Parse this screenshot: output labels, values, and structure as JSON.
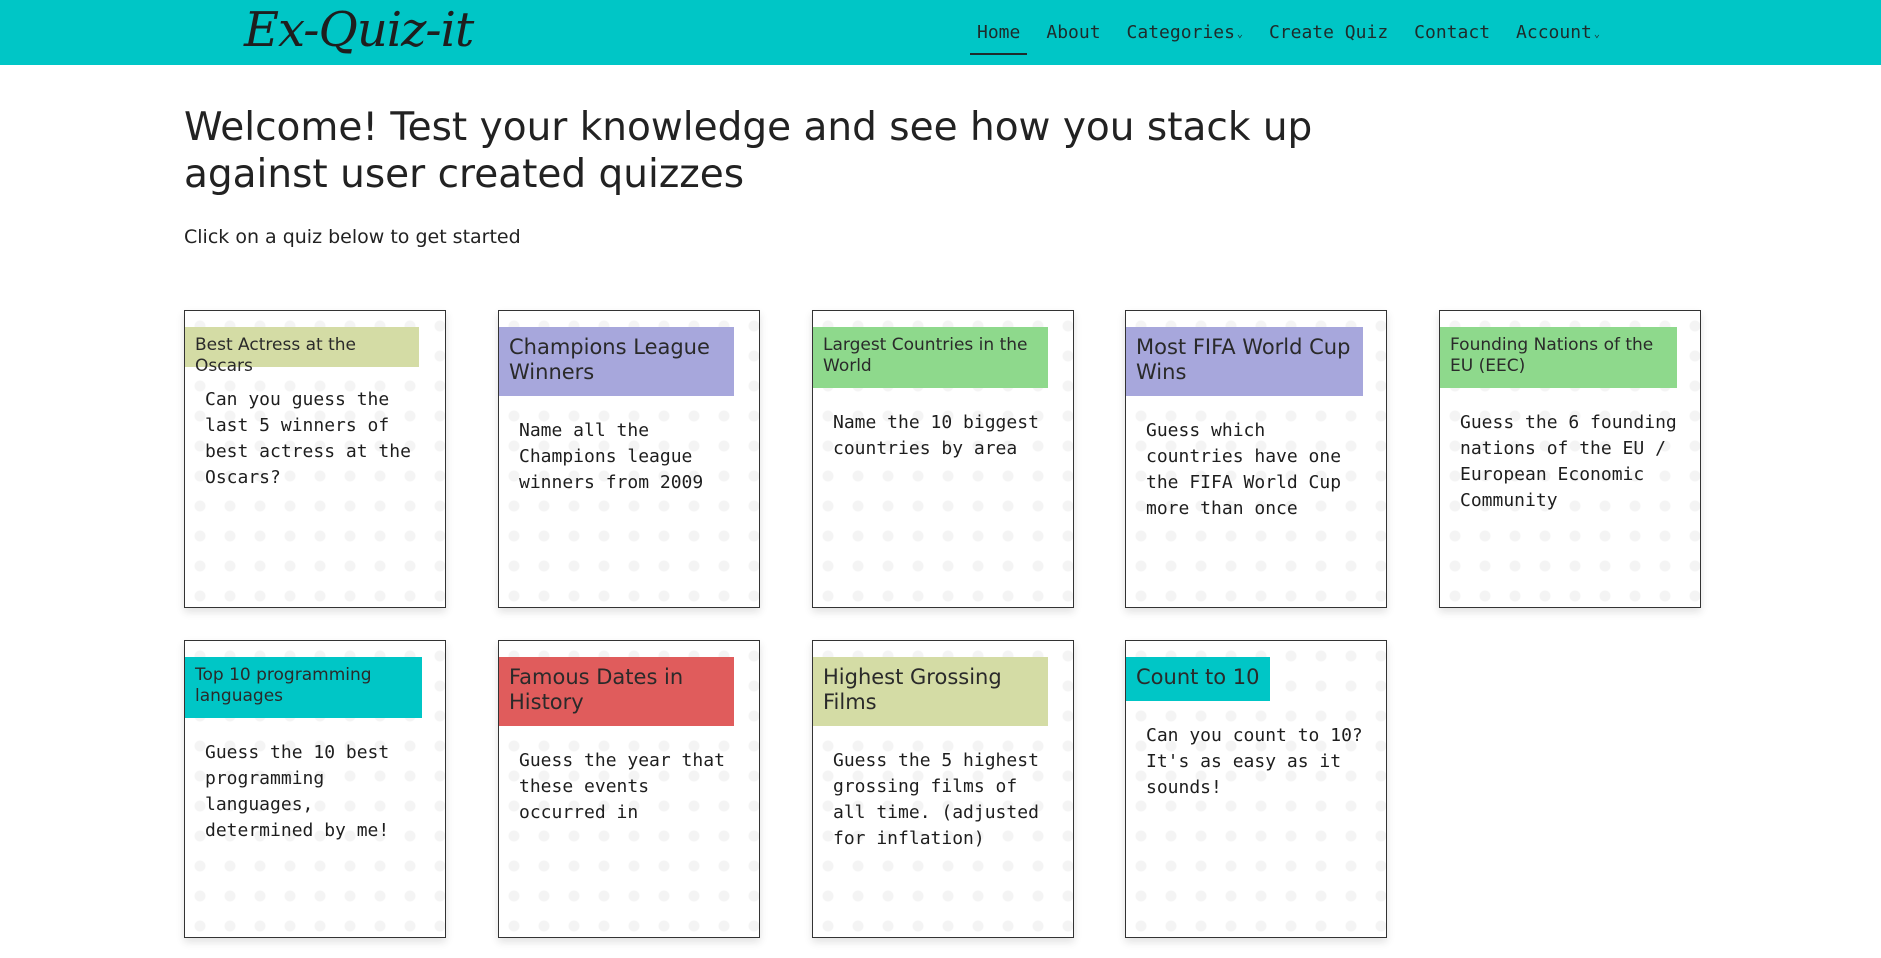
{
  "brand": "Ex-Quiz-it",
  "nav": {
    "home": "Home",
    "about": "About",
    "categories": "Categories",
    "create_quiz": "Create Quiz",
    "contact": "Contact",
    "account": "Account",
    "caret": "⌄"
  },
  "hero": {
    "title": "Welcome! Test your knowledge and see how you stack up against user created quizzes",
    "subtitle": "Click on a quiz below to get started"
  },
  "quizzes": [
    {
      "title": "Best Actress at the Oscars",
      "description": "Can you guess the last 5 winners of best actress at the Oscars?",
      "color": "#d4dca5"
    },
    {
      "title": "Champions League Winners",
      "description": "Name all the Champions league winners from 2009",
      "color": "#a7a7dc"
    },
    {
      "title": "Largest Countries in the World",
      "description": "Name the 10 biggest countries by area",
      "color": "#8ed98c"
    },
    {
      "title": "Most FIFA World Cup Wins",
      "description": "Guess which countries have one the FIFA World Cup more than once",
      "color": "#a7a7dc"
    },
    {
      "title": "Founding Nations of the EU (EEC)",
      "description": "Guess the 6 founding nations of the EU / European Economic Community",
      "color": "#8ed98c"
    },
    {
      "title": "Top 10 programming languages",
      "description": "Guess the 10 best programming languages, determined by me!",
      "color": "#00c6c6"
    },
    {
      "title": "Famous Dates in History",
      "description": "Guess the year that these events occurred in",
      "color": "#e05c5c"
    },
    {
      "title": "Highest Grossing Films",
      "description": "Guess the 5 highest grossing films of all time. (adjusted for inflation)",
      "color": "#d4dca5"
    },
    {
      "title": "Count to 10",
      "description": "Can you count to 10? It's as easy as it sounds!",
      "color": "#00c6c6"
    }
  ],
  "colors": {
    "navbar": "#00c6c6",
    "text": "#222222"
  }
}
